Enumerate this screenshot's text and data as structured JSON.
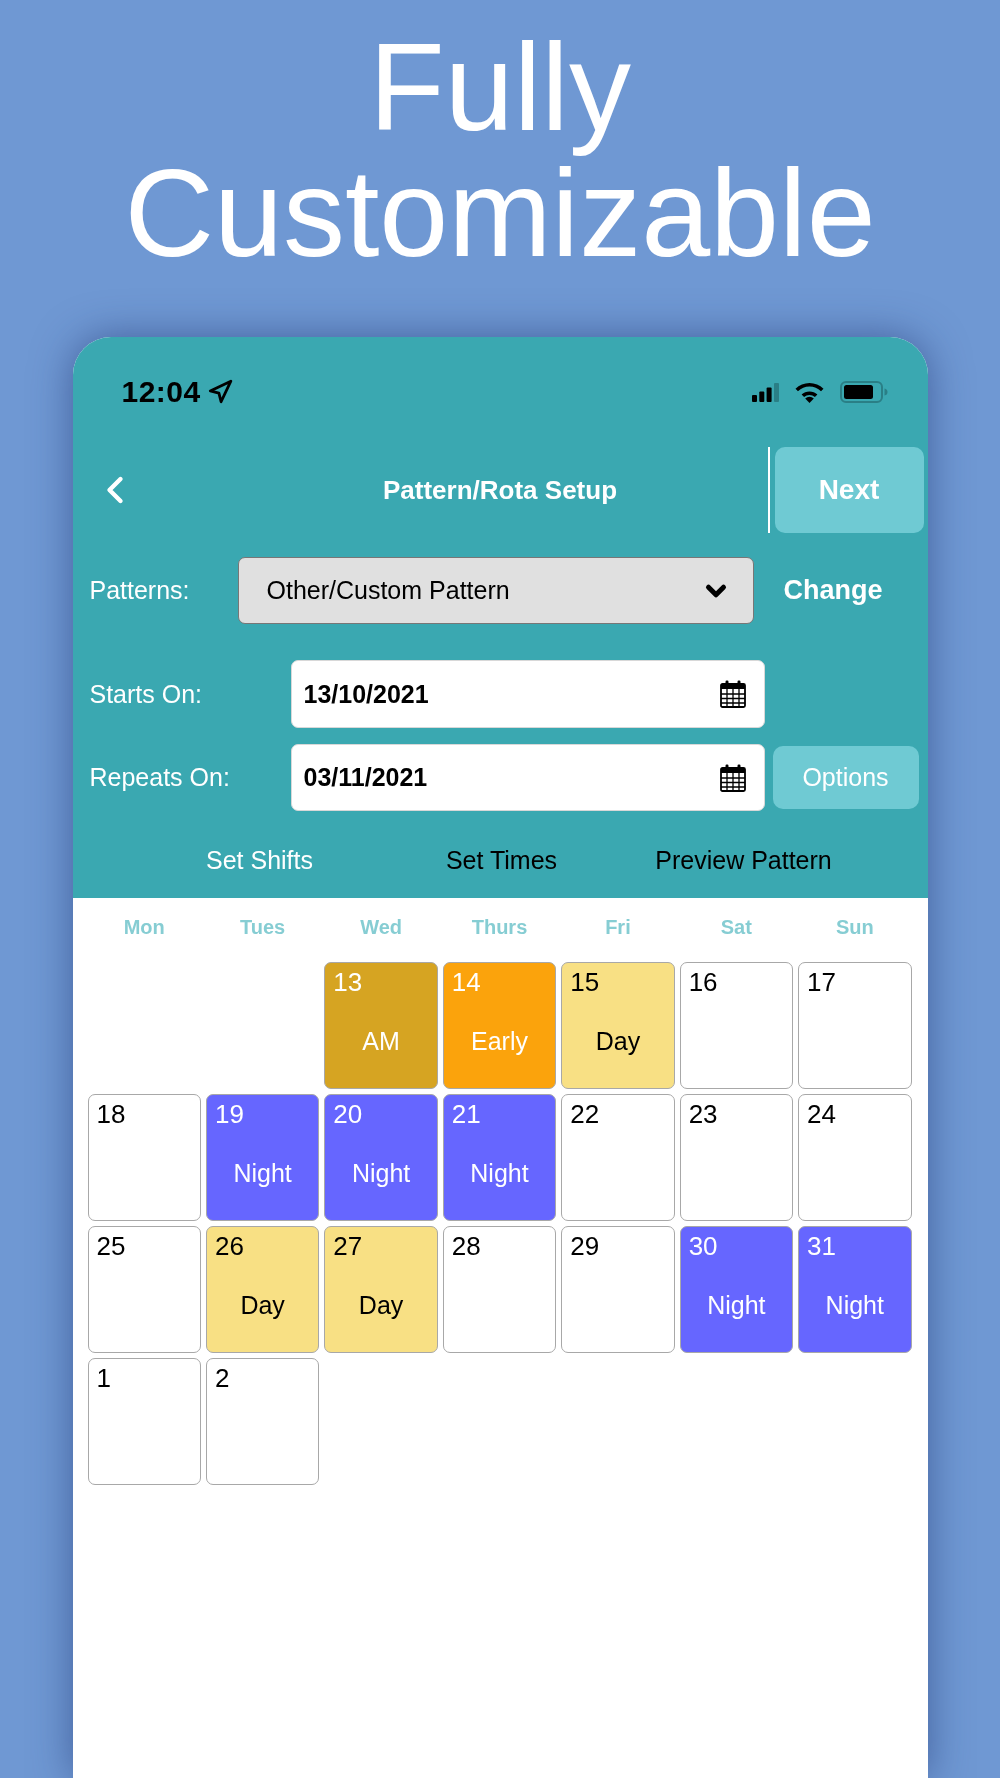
{
  "headline": "Fully Customizable",
  "status_bar": {
    "time": "12:04"
  },
  "header": {
    "title": "Pattern/Rota Setup",
    "next_button": "Next"
  },
  "pattern": {
    "label": "Patterns:",
    "value": "Other/Custom Pattern",
    "change_button": "Change"
  },
  "starts_on": {
    "label": "Starts On:",
    "value": "13/10/2021"
  },
  "repeats_on": {
    "label": "Repeats On:",
    "value": "03/11/2021",
    "options_button": "Options"
  },
  "tabs": [
    {
      "label": "Set Shifts",
      "selected": true
    },
    {
      "label": "Set Times",
      "selected": false
    },
    {
      "label": "Preview Pattern",
      "selected": false
    }
  ],
  "calendar": {
    "weekdays": [
      "Mon",
      "Tues",
      "Wed",
      "Thurs",
      "Fri",
      "Sat",
      "Sun"
    ],
    "cells": [
      {
        "kind": "blank"
      },
      {
        "kind": "blank"
      },
      {
        "kind": "shift",
        "day": "13",
        "shift": "AM",
        "color": "#d6a422"
      },
      {
        "kind": "shift",
        "day": "14",
        "shift": "Early",
        "color": "#fba30c"
      },
      {
        "kind": "shift",
        "day": "15",
        "shift": "Day",
        "color": "#f8e084"
      },
      {
        "kind": "day",
        "day": "16"
      },
      {
        "kind": "day",
        "day": "17"
      },
      {
        "kind": "day",
        "day": "18"
      },
      {
        "kind": "shift",
        "day": "19",
        "shift": "Night",
        "color": "#6666ff"
      },
      {
        "kind": "shift",
        "day": "20",
        "shift": "Night",
        "color": "#6666ff"
      },
      {
        "kind": "shift",
        "day": "21",
        "shift": "Night",
        "color": "#6666ff"
      },
      {
        "kind": "day",
        "day": "22"
      },
      {
        "kind": "day",
        "day": "23"
      },
      {
        "kind": "day",
        "day": "24"
      },
      {
        "kind": "day",
        "day": "25"
      },
      {
        "kind": "shift",
        "day": "26",
        "shift": "Day",
        "color": "#f8e084"
      },
      {
        "kind": "shift",
        "day": "27",
        "shift": "Day",
        "color": "#f8e084"
      },
      {
        "kind": "day",
        "day": "28"
      },
      {
        "kind": "day",
        "day": "29"
      },
      {
        "kind": "shift",
        "day": "30",
        "shift": "Night",
        "color": "#6666ff"
      },
      {
        "kind": "shift",
        "day": "31",
        "shift": "Night",
        "color": "#6666ff"
      },
      {
        "kind": "day",
        "day": "1"
      },
      {
        "kind": "day",
        "day": "2"
      }
    ]
  }
}
